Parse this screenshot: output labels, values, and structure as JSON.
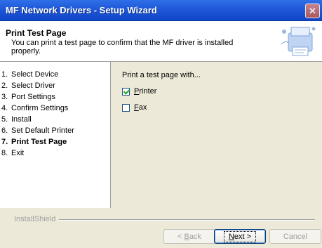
{
  "window": {
    "title": "MF Network Drivers - Setup Wizard",
    "close_glyph": "✕"
  },
  "header": {
    "title": "Print Test Page",
    "subtitle": "You can print a test page to confirm that the MF driver is installed properly."
  },
  "steps": [
    {
      "num": "1.",
      "label": "Select Device"
    },
    {
      "num": "2.",
      "label": "Select Driver"
    },
    {
      "num": "3.",
      "label": "Port Settings"
    },
    {
      "num": "4.",
      "label": "Confirm Settings"
    },
    {
      "num": "5.",
      "label": "Install"
    },
    {
      "num": "6.",
      "label": "Set Default Printer"
    },
    {
      "num": "7.",
      "label": "Print Test Page"
    },
    {
      "num": "8.",
      "label": "Exit"
    }
  ],
  "active_step": 7,
  "content": {
    "prompt": "Print a test page with...",
    "options": [
      {
        "label": "Printer",
        "checked": true
      },
      {
        "label": "Fax",
        "checked": false
      }
    ]
  },
  "footer": {
    "brand": "InstallShield",
    "back_label": "< Back",
    "next_label": "Next >",
    "cancel_label": "Cancel"
  },
  "colors": {
    "titlebar": "#1F58D8",
    "dialog_bg": "#ECE9D8",
    "check_mark": "#21A121"
  }
}
